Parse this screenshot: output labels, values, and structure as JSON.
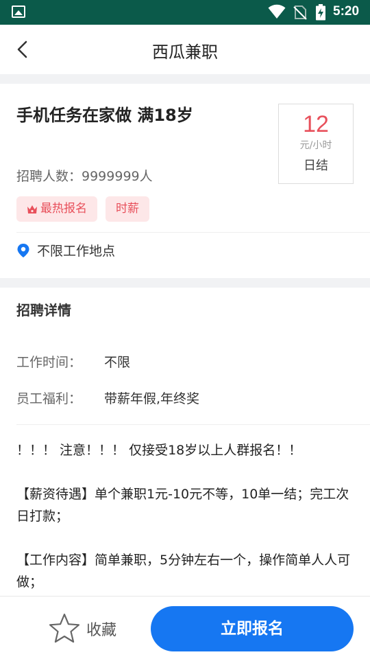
{
  "status_bar": {
    "time": "5:20"
  },
  "header": {
    "title": "西瓜兼职"
  },
  "job": {
    "title": "手机任务在家做 满18岁",
    "wage_amount": "12",
    "wage_unit": "元/小时",
    "settlement": "日结",
    "headcount": "招聘人数：9999999人",
    "tags": [
      "最热报名",
      "时薪"
    ],
    "location": "不限工作地点"
  },
  "details": {
    "section_title": "招聘详情",
    "rows": [
      {
        "label": "工作时间：",
        "value": "不限"
      },
      {
        "label": "员工福利：",
        "value": "带薪年假,年终奖"
      }
    ],
    "description": [
      "！！！ 注意！！！ 仅接受18岁以上人群报名！！",
      "【薪资待遇】单个兼职1元-10元不等，10单一结；完工次日打款；",
      "【工作内容】简单兼职，5分钟左右一个，操作简单人人可做；"
    ]
  },
  "bottom_bar": {
    "favorite_label": "收藏",
    "apply_label": "立即报名"
  },
  "colors": {
    "status_bar": "#0b5a4a",
    "accent": "#e8505b",
    "primary_button": "#1677f2",
    "location_pin": "#1677f2"
  },
  "icons": [
    "gallery-icon",
    "wifi-icon",
    "no-sim-icon",
    "battery-charging-icon",
    "back-arrow-icon",
    "crown-icon",
    "location-pin-icon",
    "star-icon"
  ]
}
